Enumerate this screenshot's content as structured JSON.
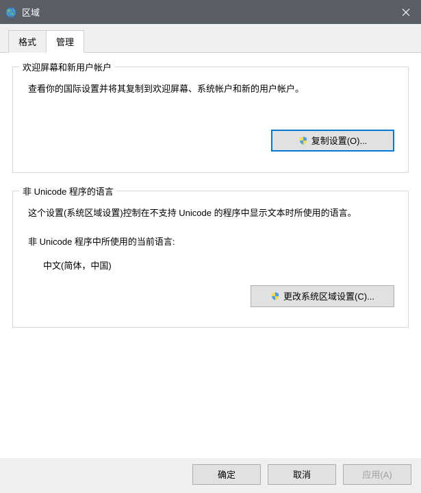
{
  "titlebar": {
    "title": "区域"
  },
  "tabs": {
    "format": "格式",
    "admin": "管理"
  },
  "group1": {
    "title": "欢迎屏幕和新用户帐户",
    "description": "查看你的国际设置并将其复制到欢迎屏幕、系统帐户和新的用户帐户。",
    "button": "复制设置(O)..."
  },
  "group2": {
    "title": "非 Unicode 程序的语言",
    "description": "这个设置(系统区域设置)控制在不支持 Unicode 的程序中显示文本时所使用的语言。",
    "currentLabel": "非 Unicode 程序中所使用的当前语言:",
    "currentValue": "中文(简体，中国)",
    "button": "更改系统区域设置(C)..."
  },
  "buttons": {
    "ok": "确定",
    "cancel": "取消",
    "apply": "应用(A)"
  }
}
